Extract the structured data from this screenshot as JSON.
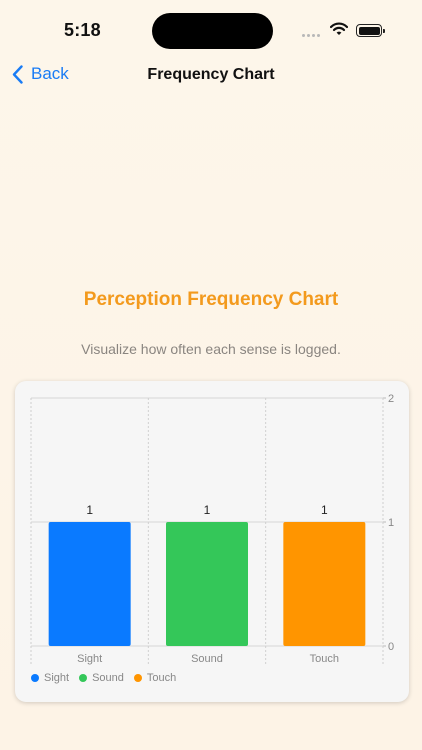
{
  "status": {
    "time": "5:18"
  },
  "nav": {
    "back_label": "Back",
    "title": "Frequency Chart"
  },
  "header": {
    "title": "Perception Frequency Chart",
    "subtitle": "Visualize how often each sense is logged."
  },
  "colors": {
    "sight": "#0a7aff",
    "sound": "#34c759",
    "touch": "#ff9500",
    "accent": "#f39a1d",
    "link": "#1a7cf5"
  },
  "chart_data": {
    "type": "bar",
    "categories": [
      "Sight",
      "Sound",
      "Touch"
    ],
    "values": [
      1,
      1,
      1
    ],
    "colors": [
      "#0a7aff",
      "#34c759",
      "#ff9500"
    ],
    "y_ticks": [
      0,
      1,
      2
    ],
    "ylim": [
      0,
      2
    ],
    "legend": [
      "Sight",
      "Sound",
      "Touch"
    ],
    "legend_position": "bottom-left",
    "grid": true
  }
}
